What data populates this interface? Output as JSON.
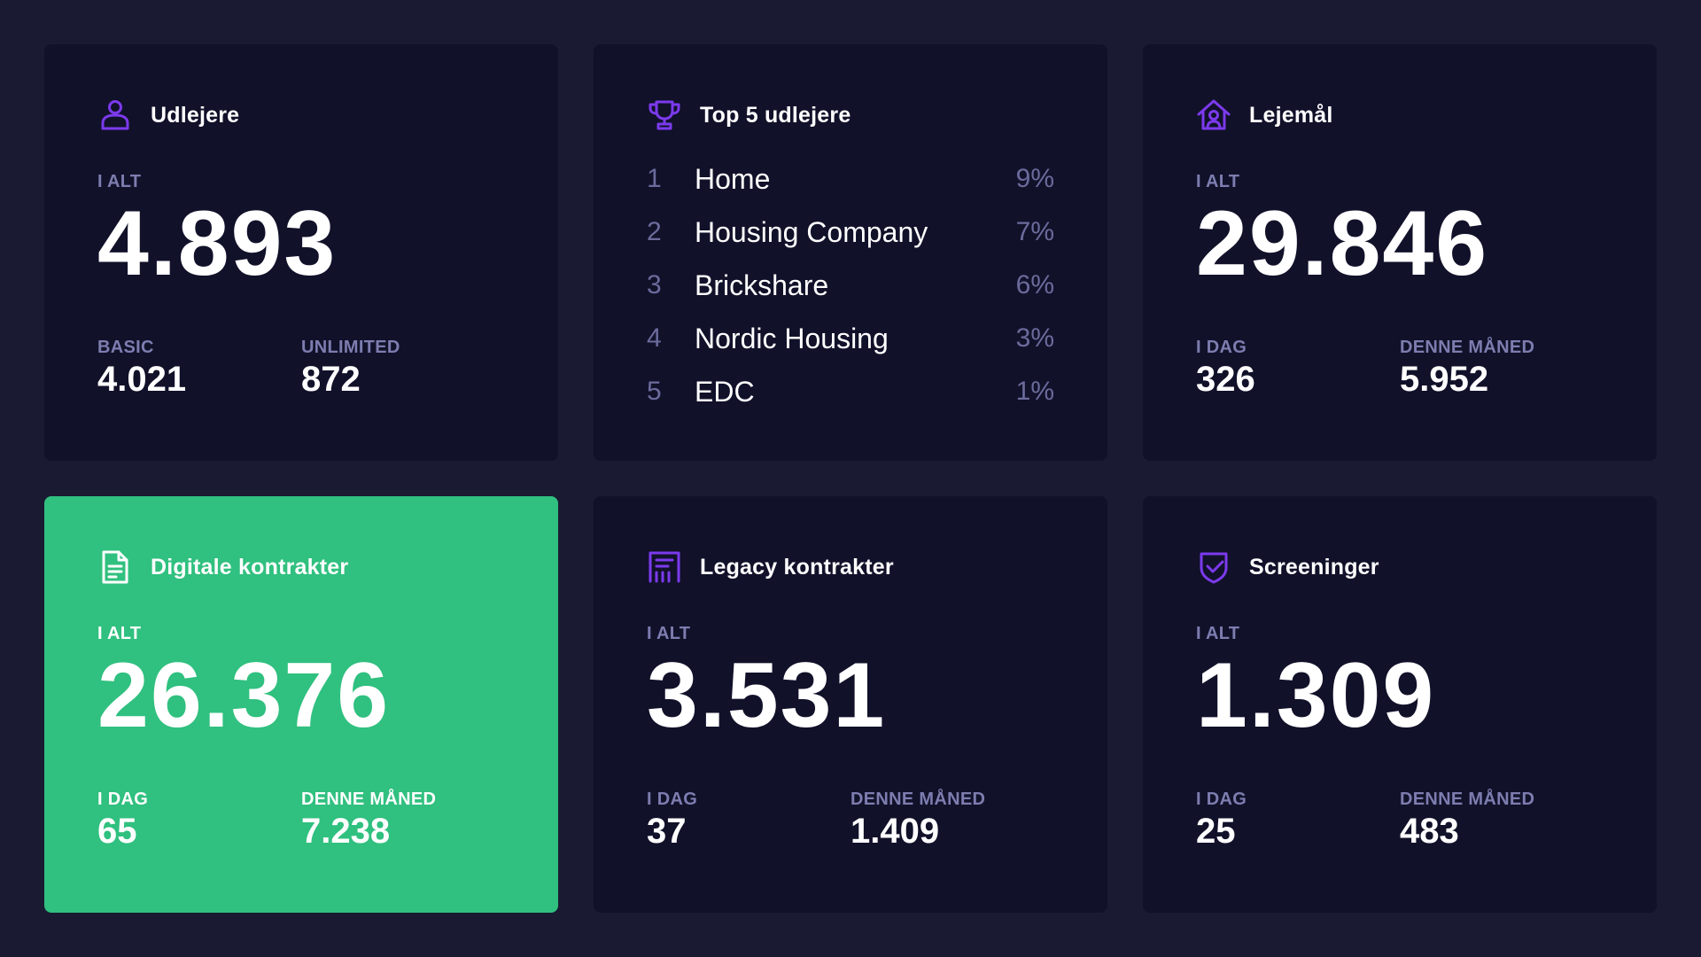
{
  "colors": {
    "background": "#1a1a33",
    "card": "#11112a",
    "accent_green": "#30c07f",
    "icon_purple": "#7c3aed",
    "muted_label": "#7d7db0"
  },
  "udlejere": {
    "icon": "user-icon",
    "title": "Udlejere",
    "total_label": "I ALT",
    "total_value": "4.893",
    "left_label": "BASIC",
    "left_value": "4.021",
    "right_label": "UNLIMITED",
    "right_value": "872"
  },
  "top5": {
    "icon": "trophy-icon",
    "title": "Top 5 udlejere",
    "items": [
      {
        "rank": "1",
        "name": "Home",
        "pct": "9%"
      },
      {
        "rank": "2",
        "name": "Housing Company",
        "pct": "7%"
      },
      {
        "rank": "3",
        "name": "Brickshare",
        "pct": "6%"
      },
      {
        "rank": "4",
        "name": "Nordic Housing",
        "pct": "3%"
      },
      {
        "rank": "5",
        "name": "EDC",
        "pct": "1%"
      }
    ]
  },
  "lejemaal": {
    "icon": "house-icon",
    "title": "Lejemål",
    "total_label": "I ALT",
    "total_value": "29.846",
    "left_label": "I DAG",
    "left_value": "326",
    "right_label": "DENNE MÅNED",
    "right_value": "5.952"
  },
  "digitale": {
    "icon": "document-icon",
    "title": "Digitale kontrakter",
    "total_label": "I ALT",
    "total_value": "26.376",
    "left_label": "I DAG",
    "left_value": "65",
    "right_label": "DENNE MÅNED",
    "right_value": "7.238"
  },
  "legacy": {
    "icon": "chart-document-icon",
    "title": "Legacy kontrakter",
    "total_label": "I ALT",
    "total_value": "3.531",
    "left_label": "I DAG",
    "left_value": "37",
    "right_label": "DENNE MÅNED",
    "right_value": "1.409"
  },
  "screeninger": {
    "icon": "shield-check-icon",
    "title": "Screeninger",
    "total_label": "I ALT",
    "total_value": "1.309",
    "left_label": "I DAG",
    "left_value": "25",
    "right_label": "DENNE MÅNED",
    "right_value": "483"
  }
}
